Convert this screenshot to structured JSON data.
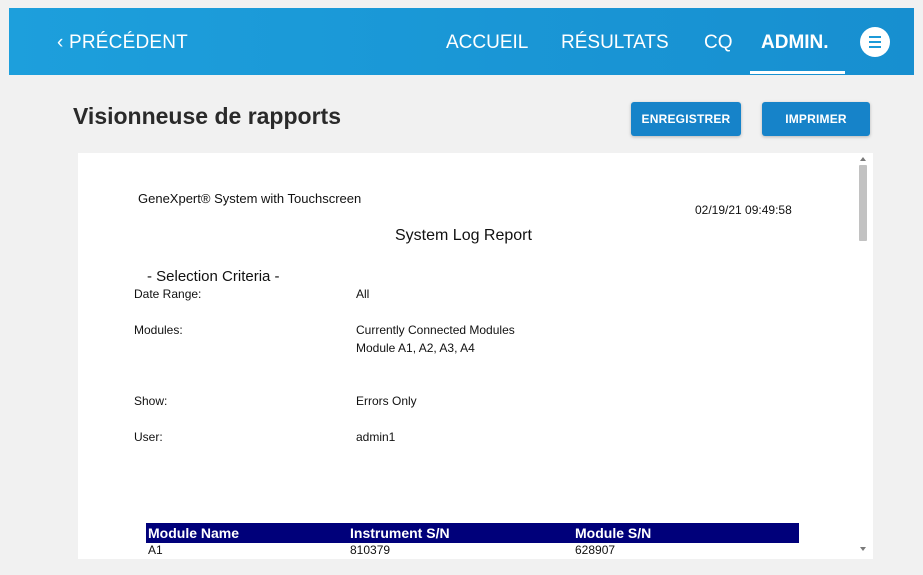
{
  "nav": {
    "back_label": "‹ PRÉCÉDENT",
    "items": [
      {
        "label": "ACCUEIL"
      },
      {
        "label": "RÉSULTATS"
      },
      {
        "label": "CQ"
      },
      {
        "label": "ADMIN."
      }
    ]
  },
  "page": {
    "title": "Visionneuse de rapports",
    "save_label": "ENREGISTRER",
    "print_label": "IMPRIMER"
  },
  "report": {
    "header": "GeneXpert® System with Touchscreen",
    "datetime": "02/19/21 09:49:58",
    "title": "System Log Report",
    "criteria_heading": "- Selection Criteria -",
    "criteria": [
      {
        "label": "Date Range:",
        "value": "All"
      },
      {
        "label": "Modules:",
        "value": "Currently Connected Modules",
        "value2": "Module A1, A2, A3, A4"
      },
      {
        "label": "Show:",
        "value": "Errors Only"
      },
      {
        "label": "User:",
        "value": "admin1"
      }
    ],
    "table": {
      "columns": [
        "Module Name",
        "Instrument S/N",
        "Module S/N"
      ],
      "rows": [
        [
          "A1",
          "810379",
          "628907"
        ]
      ]
    }
  },
  "colors": {
    "nav_bg": "#1b98d9",
    "button_bg": "#1683c9",
    "table_header_bg": "#00007a"
  }
}
